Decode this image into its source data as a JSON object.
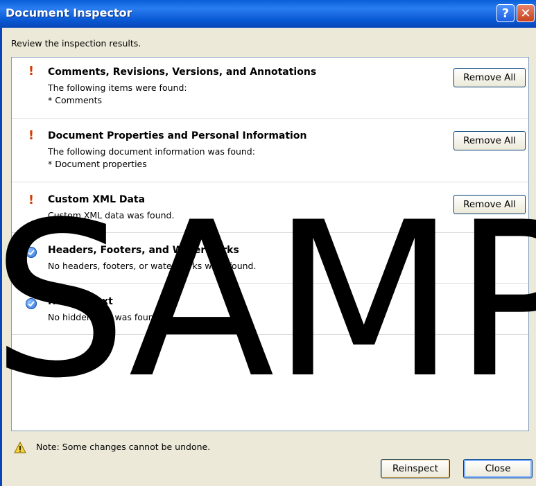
{
  "window": {
    "title": "Document Inspector",
    "help_glyph": "?",
    "close_glyph": "✕"
  },
  "subtitle": "Review the inspection results.",
  "sections": [
    {
      "status_icon": "exclamation-icon",
      "title": "Comments, Revisions, Versions, and Annotations",
      "lines": [
        "The following items were found:",
        "* Comments"
      ],
      "button": "Remove All"
    },
    {
      "status_icon": "exclamation-icon",
      "title": "Document Properties and Personal Information",
      "lines": [
        "The following document information was found:",
        "* Document properties"
      ],
      "button": "Remove All"
    },
    {
      "status_icon": "exclamation-icon",
      "title": "Custom XML Data",
      "lines": [
        "Custom XML data was found."
      ],
      "button": "Remove All"
    },
    {
      "status_icon": "checkmark-icon",
      "title": "Headers, Footers, and Watermarks",
      "lines": [
        "No headers, footers, or watermarks were found."
      ]
    },
    {
      "status_icon": "checkmark-icon",
      "title": "Hidden Text",
      "lines": [
        "No hidden text was found."
      ]
    }
  ],
  "note": "Note: Some changes cannot be undone.",
  "buttons": {
    "reinspect": "Reinspect",
    "close": "Close"
  },
  "watermark": "SAMP",
  "colors": {
    "titlebar": "#0a5fd8",
    "warning": "#d63a00",
    "check": "#2a6fd8"
  }
}
